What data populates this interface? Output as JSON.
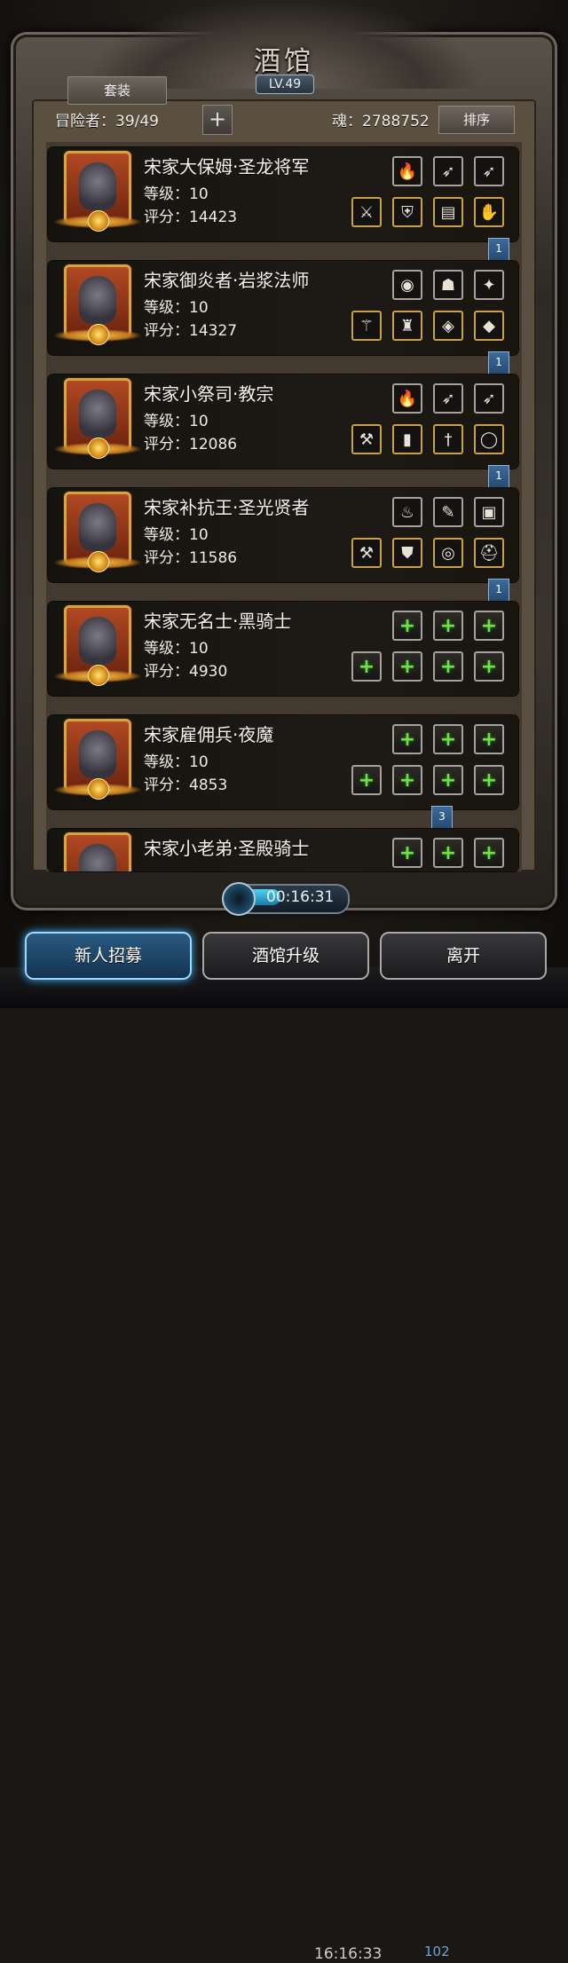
{
  "header": {
    "title": "酒馆",
    "level": "LV.49",
    "set_button": "套装",
    "adventurers": "冒险者：39/49",
    "soul": "魂：2788752",
    "sort_button": "排序",
    "add_icon": "plus-icon"
  },
  "heroes": [
    {
      "name": "宋家大保姆·圣龙将军",
      "level": "等级：10",
      "score": "评分：14423",
      "equip": [
        "fire-orb-icon",
        "bow-icon",
        "bow-icon",
        "sword-icon",
        "armor-icon",
        "scroll-icon",
        "glove-icon"
      ],
      "ribbon": "1"
    },
    {
      "name": "宋家御炎者·岩浆法师",
      "level": "等级：10",
      "score": "评分：14327",
      "equip": [
        "blue-orb-icon",
        "mask-icon",
        "claw-icon",
        "staff-icon",
        "robe-icon",
        "shoulder-icon",
        "green-gem-icon"
      ],
      "ribbon": "1"
    },
    {
      "name": "宋家小祭司·教宗",
      "level": "等级：10",
      "score": "评分：12086",
      "equip": [
        "fire-orb-icon",
        "bow-icon",
        "bow-icon",
        "axe-icon",
        "pillar-icon",
        "dagger-icon",
        "ring-icon"
      ],
      "ribbon": "1"
    },
    {
      "name": "宋家补抗王·圣光贤者",
      "level": "等级：10",
      "score": "评分：11586",
      "equip": [
        "green-flame-icon",
        "feather-icon",
        "book-icon",
        "hammer-icon",
        "green-armor-icon",
        "purple-ring-icon",
        "helmet-icon"
      ],
      "ribbon": "1"
    },
    {
      "name": "宋家无名士·黑骑士",
      "level": "等级：10",
      "score": "评分：4930",
      "equip": [
        "empty",
        "empty",
        "empty",
        "empty",
        "empty",
        "empty",
        "empty"
      ],
      "ribbon": ""
    },
    {
      "name": "宋家雇佣兵·夜魔",
      "level": "等级：10",
      "score": "评分：4853",
      "equip": [
        "empty",
        "empty",
        "empty",
        "empty",
        "empty",
        "empty",
        "empty"
      ],
      "ribbon": "3"
    },
    {
      "name": "宋家小老弟·圣殿骑士",
      "level": "",
      "score": "",
      "equip": [
        "empty",
        "empty",
        "empty"
      ],
      "ribbon": ""
    }
  ],
  "timer": "00:16:31",
  "buttons": {
    "recruit": "新人招募",
    "upgrade": "酒馆升级",
    "leave": "离开"
  },
  "status_bar": {
    "clock": "16:16:33",
    "gems": "102"
  },
  "colors": {
    "accent": "#3fb4ff",
    "gold": "#d9a345",
    "plus_green": "#6ee04c"
  }
}
